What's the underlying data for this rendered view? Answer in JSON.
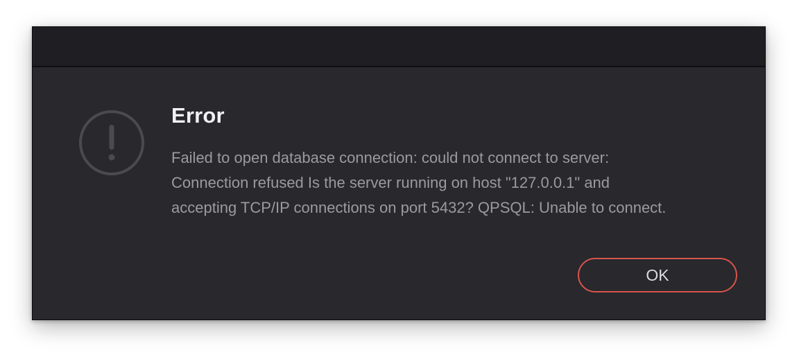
{
  "dialog": {
    "title": "Error",
    "message": "Failed to open database connection: could not connect to server:\nConnection refused Is the server running on host \"127.0.0.1\" and\naccepting TCP/IP connections on port 5432? QPSQL: Unable to connect.",
    "icon": "exclamation-circle-icon",
    "ok_label": "OK"
  },
  "colors": {
    "dialog_background": "#28282d",
    "titlebar_background": "#1f1f23",
    "title_text": "#f2f2f4",
    "message_text": "#9a9aa0",
    "button_border": "#d8544c",
    "icon": "#4a4a50"
  }
}
